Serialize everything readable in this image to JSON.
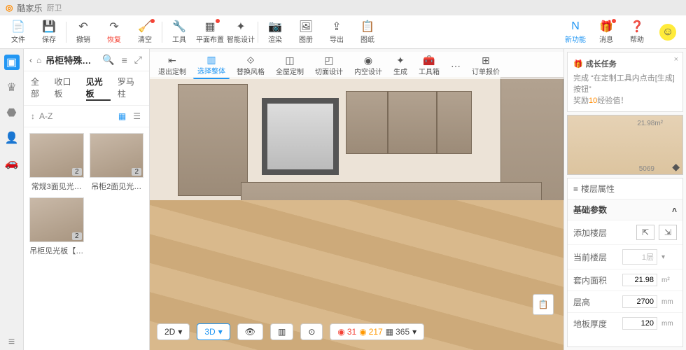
{
  "title": {
    "logo": "◎",
    "brand": "酷家乐",
    "project": "厨卫"
  },
  "maintb": [
    {
      "icon": "📄",
      "label": "文件"
    },
    {
      "icon": "💾",
      "label": "保存"
    },
    {
      "sep": true
    },
    {
      "icon": "↶",
      "label": "撤销"
    },
    {
      "icon": "↷",
      "label": "恢复",
      "cls": "red"
    },
    {
      "icon": "🧹",
      "label": "清空",
      "dot": true
    },
    {
      "sep": true
    },
    {
      "icon": "🔧",
      "label": "工具"
    },
    {
      "icon": "▦",
      "label": "平面布置",
      "dot": true
    },
    {
      "icon": "✦",
      "label": "智能设计"
    },
    {
      "sep": true
    },
    {
      "icon": "📷",
      "label": "渲染"
    },
    {
      "icon": "🖼",
      "label": "图册"
    },
    {
      "icon": "⇪",
      "label": "导出"
    },
    {
      "icon": "📋",
      "label": "图纸"
    }
  ],
  "righttb": [
    {
      "icon": "N",
      "label": "新功能",
      "cls": "blue"
    },
    {
      "icon": "🎁",
      "label": "消息",
      "dot": true
    },
    {
      "icon": "❓",
      "label": "帮助"
    }
  ],
  "rail": [
    {
      "i": "▣",
      "active": true
    },
    {
      "i": "♛"
    },
    {
      "i": "⬣"
    },
    {
      "i": "👤"
    },
    {
      "i": "🚗"
    }
  ],
  "sidebar": {
    "title": "吊柜特殊…",
    "tabs": [
      {
        "l": "全部"
      },
      {
        "l": "收口板"
      },
      {
        "l": "见光板",
        "active": true
      },
      {
        "l": "罗马柱"
      }
    ],
    "sort": "A-Z",
    "items": [
      {
        "name": "常规3面见光…",
        "badge": "2"
      },
      {
        "name": "吊柜2面见光…",
        "badge": "2"
      },
      {
        "name": "吊柜见光板【…",
        "badge": "2"
      }
    ]
  },
  "subtb": [
    {
      "i": "⇤",
      "l": "退出定制"
    },
    {
      "i": "▥",
      "l": "选择整体",
      "active": true
    },
    {
      "i": "⟐",
      "l": "替换风格"
    },
    {
      "i": "◫",
      "l": "全屋定制"
    },
    {
      "i": "◰",
      "l": "切面设计"
    },
    {
      "i": "◉",
      "l": "内空设计"
    },
    {
      "i": "✦",
      "l": "生成"
    },
    {
      "i": "🧰",
      "l": "工具箱"
    },
    {
      "i": "⋯",
      "l": ""
    },
    {
      "i": "⊞",
      "l": "订单报价"
    }
  ],
  "viewbar": {
    "v2d": "2D",
    "v3d": "3D",
    "red": "31",
    "orange": "217",
    "grid": "365"
  },
  "task": {
    "title": "成长任务",
    "line1": "完成 “在定制工具内点击[生成]按钮”",
    "line2a": "奖励",
    "line2b": "10",
    "line2c": "经验值！"
  },
  "minimap": {
    "w": "21.98m²",
    "len": "5069"
  },
  "props": {
    "title": "楼层属性",
    "section": "基础参数",
    "rows": [
      {
        "lab": "添加楼层",
        "type": "btns"
      },
      {
        "lab": "当前楼层",
        "val": "1层",
        "type": "select"
      },
      {
        "lab": "套内面积",
        "val": "21.98",
        "unit": "m²"
      },
      {
        "lab": "层高",
        "val": "2700",
        "unit": "mm"
      },
      {
        "lab": "地板厚度",
        "val": "120",
        "unit": "mm"
      }
    ]
  }
}
